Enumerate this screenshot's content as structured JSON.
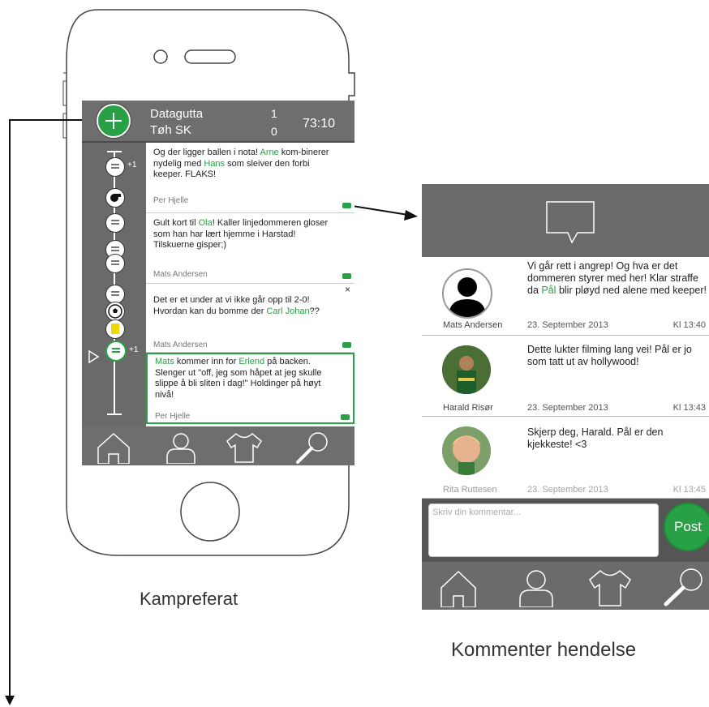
{
  "captions": {
    "left": "Kampreferat",
    "right": "Kommenter hendelse"
  },
  "match": {
    "home_team": "Datagutta",
    "away_team": "Tøh SK",
    "home_score": "1",
    "away_score": "0",
    "clock": "73:10"
  },
  "timeline": {
    "plus_labels": [
      "+1",
      "+1"
    ]
  },
  "feed": [
    {
      "parts": [
        {
          "t": "Og der ligger ballen i nota! "
        },
        {
          "t": "Arne",
          "hl": true
        },
        {
          "t": " kom-binerer nydelig med "
        },
        {
          "t": "Hans",
          "hl": true
        },
        {
          "t": " som sleiver den forbi keeper. FLAKS!"
        }
      ],
      "author": "Per Hjelle"
    },
    {
      "parts": [
        {
          "t": "Gult kort til "
        },
        {
          "t": "Ola",
          "hl": true
        },
        {
          "t": "! Kaller linjedommeren gloser som han har lært hjemme i Harstad! Tilskuerne gisper;)"
        }
      ],
      "author": "Mats Andersen"
    },
    {
      "parts": [
        {
          "t": "Det er et under at vi ikke går opp til 2-0! Hvordan kan du bomme der "
        },
        {
          "t": "Carl Johan",
          "hl": true
        },
        {
          "t": "??"
        }
      ],
      "author": "Mats Andersen",
      "close": "×"
    },
    {
      "parts": [
        {
          "t": "Mats",
          "hl": true
        },
        {
          "t": " kommer inn for "
        },
        {
          "t": "Erlend",
          "hl": true
        },
        {
          "t": " på backen. Slenger ut \"off, jeg som håpet at jeg skulle slippe å bli sliten i dag!\" Holdinger på høyt nivå!"
        }
      ],
      "author": "Per Hjelle"
    }
  ],
  "comments": [
    {
      "parts": [
        {
          "t": "Vi går rett i angrep! Og hva er det dommeren styrer med her! Klar straffe da "
        },
        {
          "t": "Pål",
          "hl": true
        },
        {
          "t": " blir pløyd ned alene med keeper!"
        }
      ],
      "name": "Mats Andersen",
      "date": "23. September 2013",
      "time": "Kl 13:40"
    },
    {
      "parts": [
        {
          "t": "Dette lukter filming lang vei! Pål er jo som tatt ut av hollywood!"
        }
      ],
      "name": "Harald Risør",
      "date": "23. September 2013",
      "time": "Kl 13:43"
    },
    {
      "parts": [
        {
          "t": "Skjerp deg, Harald. Pål er den kjekkeste! <3"
        }
      ],
      "name": "Rita Ruttesen",
      "date": "23. September 2013",
      "time": "Kl 13:45"
    }
  ],
  "comment_input": {
    "placeholder": "Skriv din kommentar..."
  },
  "post_button": "Post",
  "colors": {
    "accent": "#27a046",
    "bar": "#6b6b6b"
  }
}
